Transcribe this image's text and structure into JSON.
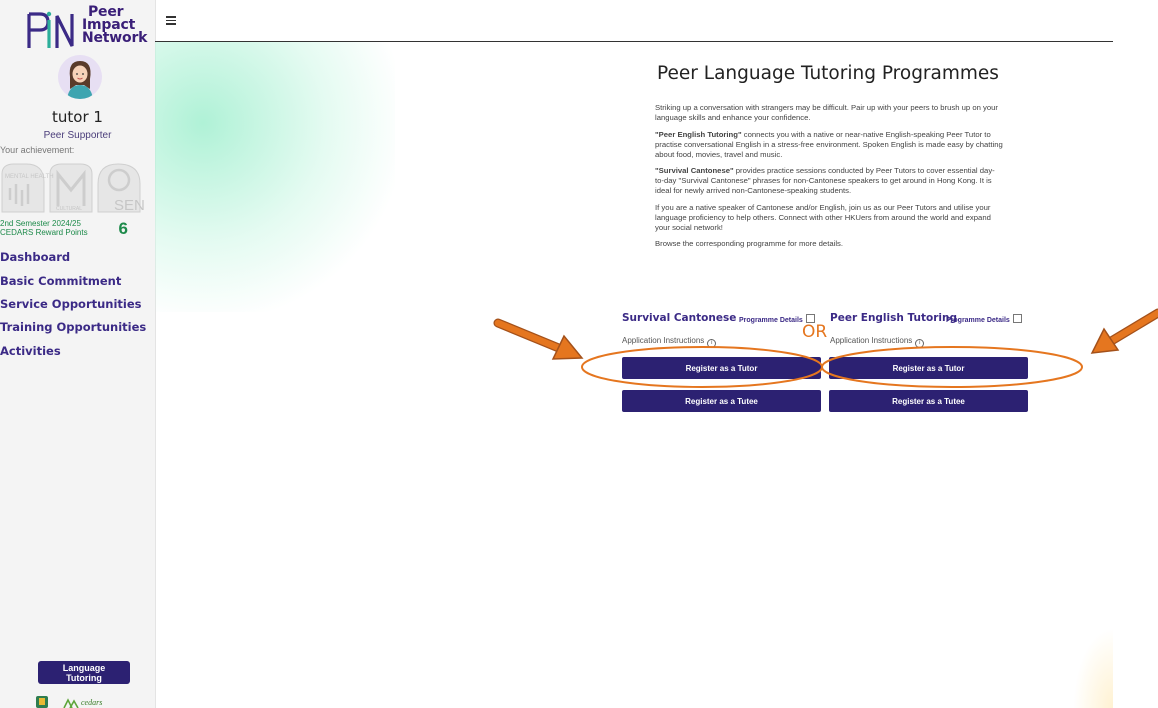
{
  "logo": {
    "line1": "Peer",
    "line2": "Impact",
    "line3": "Network"
  },
  "user": {
    "name": "tutor 1",
    "role": "Peer Supporter"
  },
  "achievement_label": "Your achievement:",
  "badges": [
    "MENTAL HEALTH",
    "CULTURAL",
    "SEN"
  ],
  "points": {
    "line1": "2nd Semester 2024/25",
    "line2": "CEDARS Reward Points",
    "value": "6"
  },
  "nav": [
    "Dashboard",
    "Basic Commitment",
    "Service Opportunities",
    "Training Opportunities",
    "Activities"
  ],
  "sidebar_button": "Language Tutoring",
  "page_title": "Peer Language Tutoring Programmes",
  "intro": {
    "p1": "Striking up a conversation with strangers may be difficult. Pair up with your peers to brush up on your language skills and enhance your confidence.",
    "p2_bold": "\"Peer English Tutoring\"",
    "p2_rest": " connects you with a native or near-native English-speaking Peer Tutor to practise conversational English in a stress-free environment. Spoken English is made easy by chatting about food, movies, travel and music.",
    "p3_bold": "\"Survival Cantonese\"",
    "p3_rest": " provides practice sessions conducted by Peer Tutors to cover essential day-to-day \"Survival Cantonese\" phrases for non-Cantonese speakers to get around in Hong Kong. It is ideal for newly arrived non-Cantonese-speaking students.",
    "p4": "If you are a native speaker of Cantonese and/or English, join us as our Peer Tutors and utilise your language proficiency to help others. Connect with other HKUers from around the world and expand your social network!",
    "p5": "Browse the corresponding programme for more details."
  },
  "programmes": [
    {
      "title": "Survival Cantonese",
      "details": "Programme Details",
      "instructions": "Application Instructions",
      "tutor": "Register as a Tutor",
      "tutee": "Register as a Tutee"
    },
    {
      "title": "Peer English Tutoring",
      "details": "Programme Details",
      "instructions": "Application Instructions",
      "tutor": "Register as a Tutor",
      "tutee": "Register as a Tutee"
    }
  ],
  "annotation": {
    "or_text": "OR",
    "color": "#e5761f"
  },
  "colors": {
    "primary": "#2c2172",
    "nav": "#3b2a86",
    "points": "#1d8a4a"
  }
}
